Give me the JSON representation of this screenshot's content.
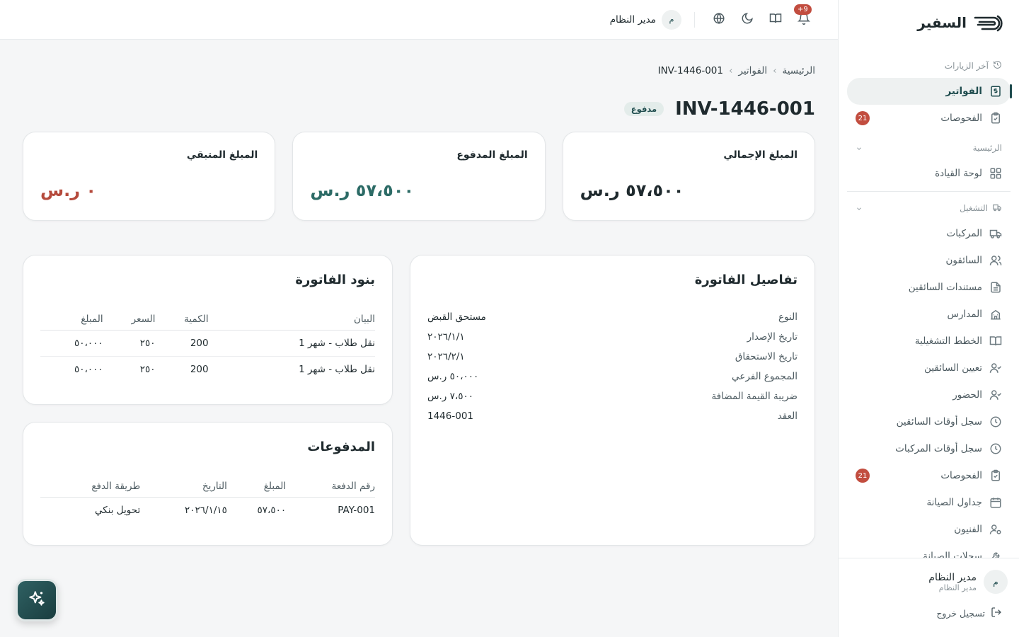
{
  "brand": {
    "name": "السفير"
  },
  "sidebar": {
    "recent_label": "آخر الزيارات",
    "recent_items": [
      {
        "label": "الفواتير",
        "icon": "invoice-icon",
        "active": true
      },
      {
        "label": "الفحوصات",
        "icon": "clipboard-check-icon",
        "badge": "21"
      }
    ],
    "main_section": "الرئيسية",
    "main_items": [
      {
        "label": "لوحة القيادة",
        "icon": "dashboard-icon"
      }
    ],
    "ops_section": "التشغيل",
    "ops_items": [
      {
        "label": "المركبات",
        "icon": "truck-icon"
      },
      {
        "label": "السائقون",
        "icon": "users-icon"
      },
      {
        "label": "مستندات السائقين",
        "icon": "document-icon"
      },
      {
        "label": "المدارس",
        "icon": "school-icon"
      },
      {
        "label": "الخطط التشغيلية",
        "icon": "book-icon"
      },
      {
        "label": "تعيين السائقين",
        "icon": "user-check-icon"
      },
      {
        "label": "الحضور",
        "icon": "user-check-icon"
      },
      {
        "label": "سجل أوقات السائقين",
        "icon": "clock-icon"
      },
      {
        "label": "سجل أوقات المركبات",
        "icon": "clock-icon"
      },
      {
        "label": "الفحوصات",
        "icon": "clipboard-check-icon",
        "badge": "21"
      },
      {
        "label": "جداول الصيانة",
        "icon": "calendar-icon"
      },
      {
        "label": "الفنيون",
        "icon": "user-cog-icon"
      },
      {
        "label": "سجلات الصيانة",
        "icon": "wrench-icon"
      }
    ],
    "footer": {
      "user_name": "مدير النظام",
      "user_role": "مدير النظام",
      "avatar_letter": "م",
      "logout_label": "تسجيل خروج"
    }
  },
  "topbar": {
    "notifications_count": "+9",
    "user_name": "مدير النظام",
    "avatar_letter": "م"
  },
  "breadcrumb": [
    "الرئيسية",
    "الفواتير",
    "INV-1446-001"
  ],
  "page": {
    "title": "INV-1446-001",
    "status": "مدفوع"
  },
  "stats": [
    {
      "label": "المبلغ الإجمالي",
      "value": "٥٧،٥٠٠ ر.س",
      "color": "#1f2a2e"
    },
    {
      "label": "المبلغ المدفوع",
      "value": "٥٧،٥٠٠ ر.س",
      "color": "#2c6b66"
    },
    {
      "label": "المبلغ المتبقي",
      "value": "٠ ر.س",
      "color": "#b54a3c"
    }
  ],
  "details": {
    "title": "تفاصيل الفاتورة",
    "rows": [
      {
        "k": "النوع",
        "v": "مستحق القبض"
      },
      {
        "k": "تاريخ الإصدار",
        "v": "٢٠٢٦/١/١"
      },
      {
        "k": "تاريخ الاستحقاق",
        "v": "٢٠٢٦/٢/١"
      },
      {
        "k": "المجموع الفرعي",
        "v": "٥٠،٠٠٠ ر.س"
      },
      {
        "k": "ضريبة القيمة المضافة",
        "v": "٧،٥٠٠ ر.س"
      },
      {
        "k": "العقد",
        "v": "1446-001"
      }
    ]
  },
  "items": {
    "title": "بنود الفاتورة",
    "columns": [
      "البيان",
      "الكمية",
      "السعر",
      "المبلغ"
    ],
    "rows": [
      [
        "نقل طلاب - شهر 1",
        "200",
        "٢٥٠",
        "٥٠،٠٠٠"
      ],
      [
        "نقل طلاب - شهر 1",
        "200",
        "٢٥٠",
        "٥٠،٠٠٠"
      ]
    ]
  },
  "payments": {
    "title": "المدفوعات",
    "columns": [
      "رقم الدفعة",
      "المبلغ",
      "التاريخ",
      "طريقة الدفع"
    ],
    "rows": [
      [
        "PAY-001",
        "٥٧،٥٠٠",
        "٢٠٢٦/١/١٥",
        "تحويل بنكي"
      ]
    ]
  }
}
